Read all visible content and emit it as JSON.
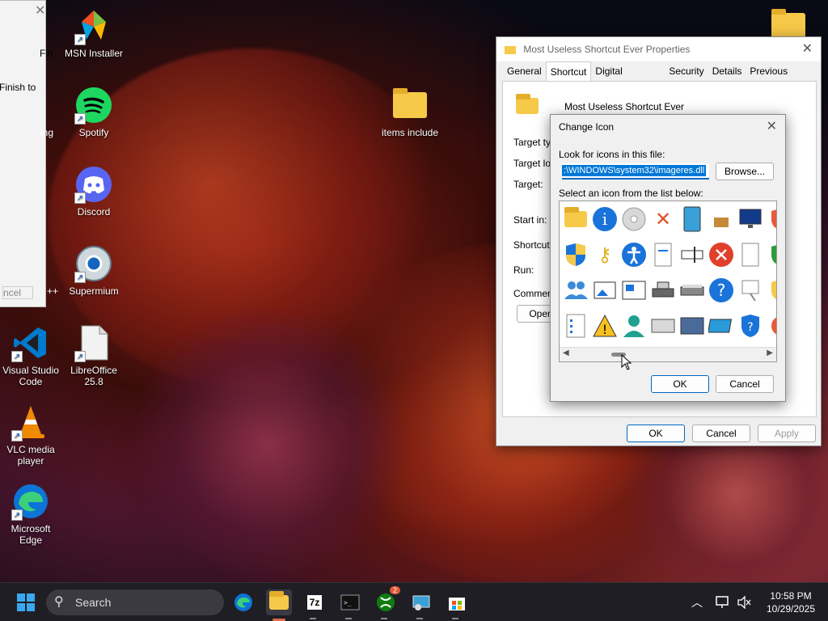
{
  "desktop": {
    "icons": [
      {
        "label": "MSN Installer",
        "icon": "msn-installer-icon"
      },
      {
        "label": "Spotify",
        "icon": "spotify-icon"
      },
      {
        "label": "Discord",
        "icon": "discord-icon"
      },
      {
        "label": "Supermium",
        "icon": "supermium-icon"
      },
      {
        "label": "Visual Studio Code",
        "icon": "vscode-icon"
      },
      {
        "label": "LibreOffice 25.8",
        "icon": "libreoffice-icon"
      },
      {
        "label": "VLC media player",
        "icon": "vlc-icon"
      },
      {
        "label": "Microsoft Edge",
        "icon": "edge-icon"
      },
      {
        "label": "items include",
        "icon": "folder-icon"
      },
      {
        "label": "",
        "icon": "folder-icon"
      }
    ],
    "left_window": {
      "fragments": [
        "Fin",
        "Finish to",
        "ing",
        "++",
        "ncel"
      ]
    }
  },
  "properties": {
    "title": "Most Useless Shortcut Ever Properties",
    "tabs": [
      "General",
      "Shortcut",
      "Digital Signatures",
      "Security",
      "Details",
      "Previous Versions"
    ],
    "active_tab": "Shortcut",
    "name": "Most Useless Shortcut Ever",
    "field_labels": [
      "Target typ",
      "Target loc",
      "Target:",
      "Start in:",
      "Shortcut k",
      "Run:",
      "Comment:"
    ],
    "open_label": "Open",
    "ok": "OK",
    "cancel": "Cancel",
    "apply": "Apply"
  },
  "change_icon": {
    "title": "Change Icon",
    "look_label": "Look for icons in this file:",
    "file_value": ":\\WINDOWS\\system32\\imageres.dll",
    "browse": "Browse...",
    "select_label": "Select an icon from the list below:",
    "ok": "OK",
    "cancel": "Cancel",
    "icons": [
      "font-folder-icon",
      "info-icon",
      "cd-icon",
      "red-x-icon",
      "tablet-icon",
      "box-icon",
      "monitor-icon",
      "shield-icon",
      "uac-shield-icon",
      "key-icon",
      "accessibility-icon",
      "document-icon",
      "text-cursor-icon",
      "error-icon",
      "blank-page-icon",
      "green-shield-icon",
      "users-icon",
      "picture-icon",
      "photo-frame-icon",
      "printer-icon",
      "scanner-icon",
      "help-icon",
      "presentation-icon",
      "yellow-shield-icon",
      "checklist-icon",
      "warning-icon",
      "user-icon",
      "device-icon",
      "card-icon",
      "screen-icon",
      "shield-help-icon",
      "red-icon"
    ]
  },
  "taskbar": {
    "search_placeholder": "Search",
    "time": "10:58 PM",
    "date": "10/29/2025",
    "xbox_badge": "2",
    "apps": [
      "start-icon",
      "search-icon",
      "edge-icon",
      "file-explorer-icon",
      "7zip-icon",
      "terminal-icon",
      "xbox-icon",
      "network-app-icon",
      "store-icon"
    ]
  }
}
